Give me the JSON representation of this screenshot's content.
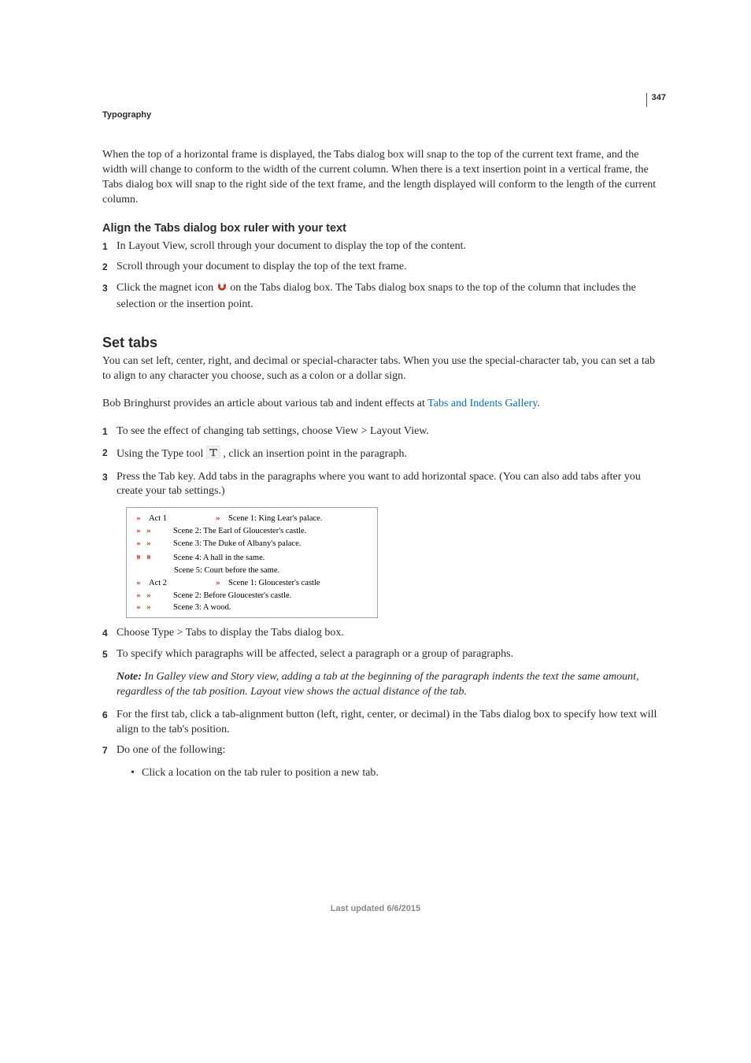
{
  "pageNumber": "347",
  "sectionHeader": "Typography",
  "intro": "When the top of a horizontal frame is displayed, the Tabs dialog box will snap to the top of the current text frame, and the width will change to conform to the width of the current column. When there is a text insertion point in a vertical frame, the Tabs dialog box will snap to the right side of the text frame, and the length displayed will conform to the length of the current column.",
  "alignHeading": "Align the Tabs dialog box ruler with your text",
  "alignSteps": {
    "s1": "In Layout View, scroll through your document to display the top of the content.",
    "s2": "Scroll through your document to display the top of the text frame.",
    "s3a": "Click the magnet icon ",
    "s3b": " on the Tabs dialog box. The Tabs dialog box snaps to the top of the column that includes the selection or the insertion point."
  },
  "setTabsHeading": "Set tabs",
  "setTabsIntro1": "You can set left, center, right, and decimal or special-character tabs. When you use the special-character tab, you can set a tab to align to any character you choose, such as a colon or a dollar sign.",
  "setTabsIntro2a": "Bob Bringhurst provides an article about various tab and indent effects at ",
  "setTabsLink": "Tabs and Indents Gallery",
  "setTabsIntro2b": ".",
  "setTabsSteps": {
    "s1": "To see the effect of changing tab settings, choose View > Layout View.",
    "s2a": "Using the Type tool ",
    "s2b": " , click an insertion point in the paragraph.",
    "s3": "Press the Tab key. Add tabs in the paragraphs where you want to add horizontal space. (You can also add tabs after you create your tab settings.)",
    "s4": "Choose Type > Tabs to display the Tabs dialog box.",
    "s5": "To specify which paragraphs will be affected, select a paragraph or a group of paragraphs.",
    "noteLabel": "Note:",
    "noteBody": " In Galley view and Story view, adding a tab at the beginning of the paragraph indents the text the same amount, regardless of the tab position. Layout view shows the actual distance of the tab.",
    "s6": "For the first tab, click a tab-alignment button (left, right, center, or decimal) in the Tabs dialog box to specify how text will align to the tab's position.",
    "s7": "Do one of the following:",
    "bullet1": "Click a location on the tab ruler to position a new tab."
  },
  "figure": {
    "r1_act": "Act 1",
    "r1_scene": "Scene 1: King Lear's palace.",
    "r2": "Scene 2: The Earl of Gloucester's castle.",
    "r3": "Scene 3: The Duke of Albany's palace.",
    "r4": "Scene 4: A hall in the same.",
    "r5": "Scene 5: Court before the same.",
    "r6_act": "Act 2",
    "r6_scene": "Scene 1: Gloucester's castle",
    "r7": "Scene 2: Before Gloucester's castle.",
    "r8": "Scene 3: A wood."
  },
  "footer": "Last updated 6/6/2015"
}
